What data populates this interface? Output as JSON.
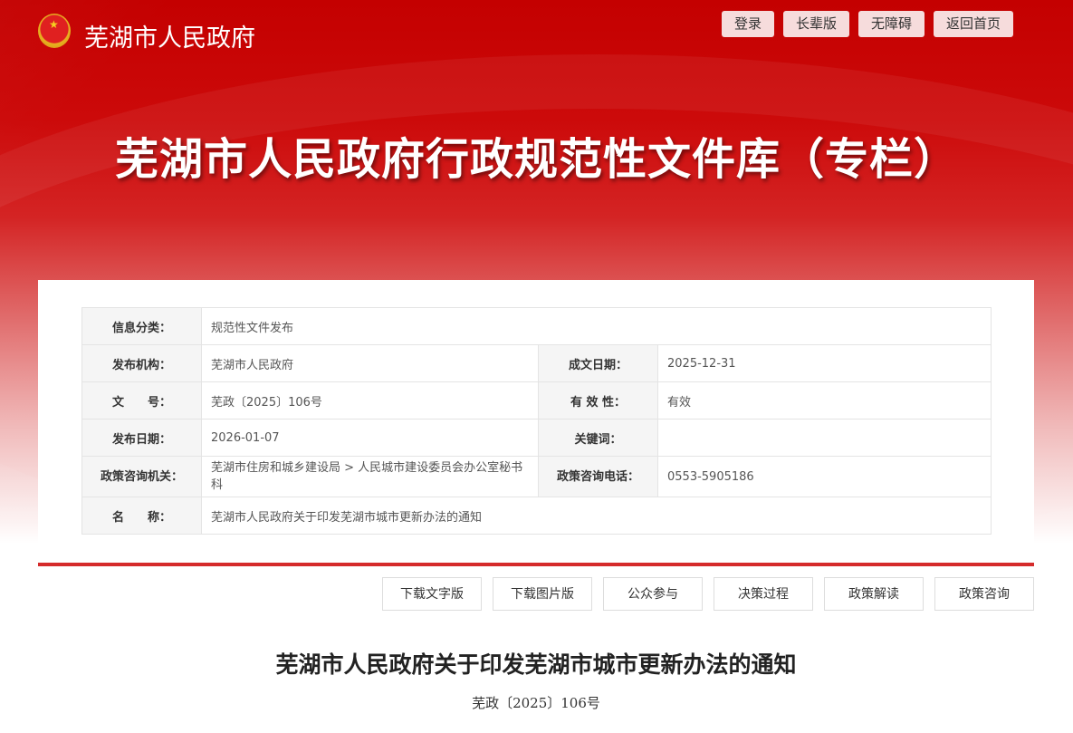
{
  "header": {
    "site_name": "芜湖市人民政府",
    "buttons": [
      "登录",
      "长辈版",
      "无障碍",
      "返回首页"
    ],
    "banner_title": "芜湖市人民政府行政规范性文件库（专栏）"
  },
  "info": {
    "category_label": "信息分类：",
    "category": "规范性文件发布",
    "org_label": "发布机构：",
    "org": "芜湖市人民政府",
    "date_label": "成文日期：",
    "date": "2025-12-31",
    "docno_label": "文　　号：",
    "docno": "芜政〔2025〕106号",
    "validity_label": "有 效 性：",
    "validity": "有效",
    "pubdate_label": "发布日期：",
    "pubdate": "2026-01-07",
    "keywords_label": "关键词：",
    "keywords": "",
    "consult_org_label": "政策咨询机关：",
    "consult_org": "芜湖市住房和城乡建设局 > 人民城市建设委员会办公室秘书科",
    "consult_tel_label": "政策咨询电话：",
    "consult_tel": "0553-5905186",
    "name_label": "名　　称：",
    "name": "芜湖市人民政府关于印发芜湖市城市更新办法的通知"
  },
  "actions": [
    "下载文字版",
    "下载图片版",
    "公众参与",
    "决策过程",
    "政策解读",
    "政策咨询"
  ],
  "document": {
    "title": "芜湖市人民政府关于印发芜湖市城市更新办法的通知",
    "number": "芜政〔2025〕106号"
  }
}
